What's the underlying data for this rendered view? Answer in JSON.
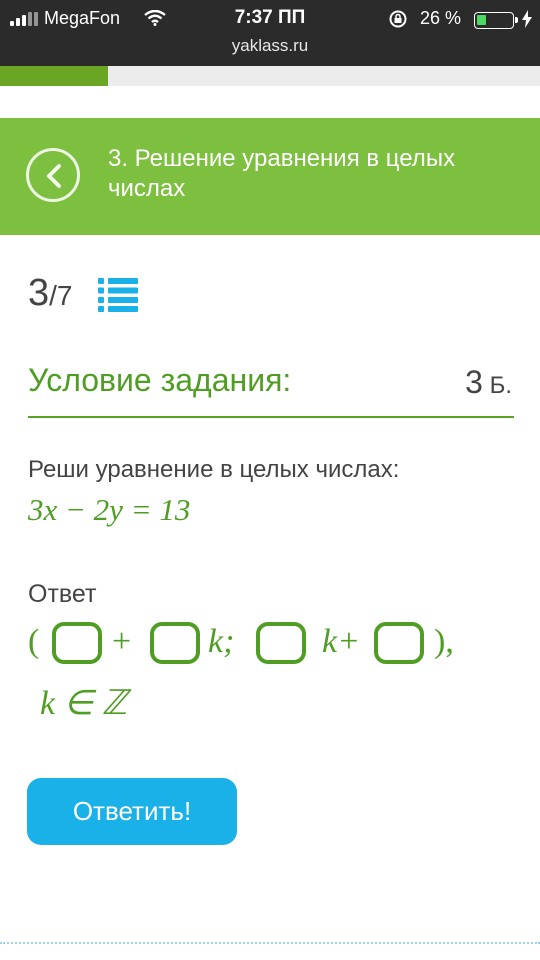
{
  "status_bar": {
    "carrier": "MegaFon",
    "time": "7:37 ПП",
    "battery_percent": "26 %",
    "battery_level": 0.26,
    "url": "yaklass.ru"
  },
  "progress": {
    "fraction": 0.2
  },
  "header": {
    "title": "3. Решение уравнения в целых числах"
  },
  "task_counter": {
    "current": "3",
    "total": "/7"
  },
  "condition": {
    "title": "Условие задания:",
    "points_value": "3",
    "points_unit": " Б.",
    "text": "Реши уравнение в целых числах:",
    "equation": "3x − 2y = 13"
  },
  "answer": {
    "label": "Ответ",
    "open_paren": "(",
    "plus_1": "+",
    "k_semicolon": "k;",
    "k_plus": "k+",
    "close_paren": "),",
    "k_in_z": "k ∈ ℤ",
    "inputs": [
      "",
      "",
      "",
      ""
    ]
  },
  "submit": {
    "label": "Ответить!"
  },
  "colors": {
    "header_green": "#7dbf3f",
    "text_green": "#4f9d22",
    "button_blue": "#1ab0e8",
    "progress_green": "#6aa624"
  }
}
